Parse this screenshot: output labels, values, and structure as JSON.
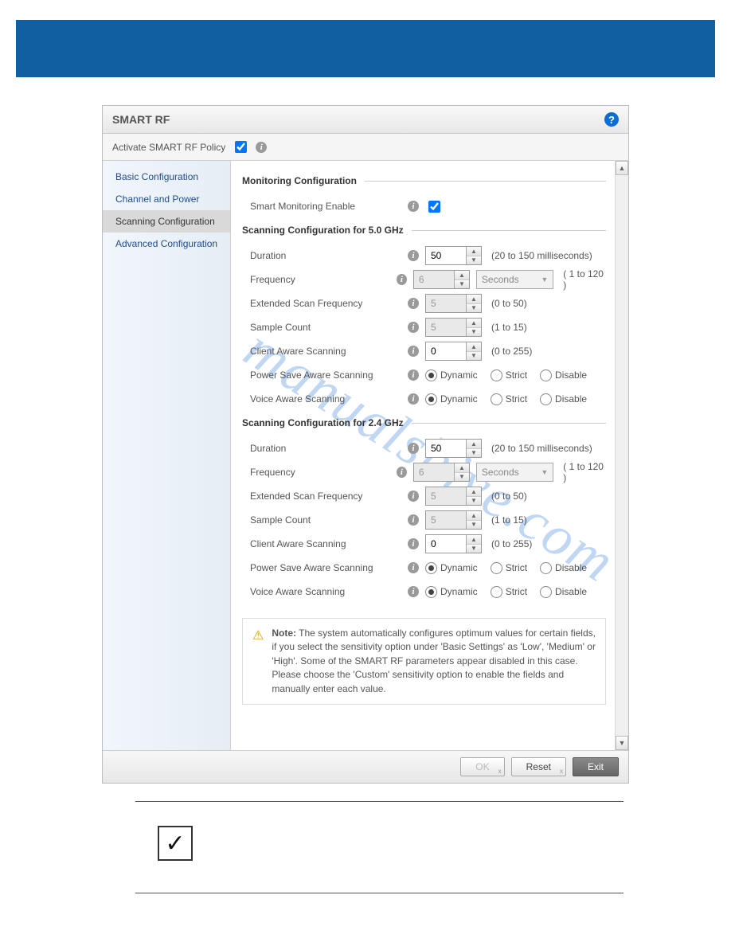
{
  "panel": {
    "title": "SMART RF",
    "activateLabel": "Activate SMART RF Policy",
    "activateChecked": true
  },
  "sidebar": {
    "items": [
      {
        "label": "Basic Configuration",
        "selected": false
      },
      {
        "label": "Channel and Power",
        "selected": false
      },
      {
        "label": "Scanning Configuration",
        "selected": true
      },
      {
        "label": "Advanced Configuration",
        "selected": false
      }
    ]
  },
  "sections": {
    "monitoring": {
      "title": "Monitoring Configuration",
      "smartMonitoring": {
        "label": "Smart Monitoring Enable",
        "checked": true
      }
    },
    "cfg5": {
      "title": "Scanning Configuration for 5.0 GHz",
      "duration": {
        "label": "Duration",
        "value": "50",
        "hint": "(20 to 150 milliseconds)"
      },
      "frequency": {
        "label": "Frequency",
        "value": "6",
        "unit": "Seconds",
        "hint": "( 1 to 120 )",
        "disabled": true
      },
      "extFreq": {
        "label": "Extended Scan Frequency",
        "value": "5",
        "hint": "(0 to 50)",
        "disabled": true
      },
      "sampleCount": {
        "label": "Sample Count",
        "value": "5",
        "hint": "(1 to 15)",
        "disabled": true
      },
      "clientAware": {
        "label": "Client Aware Scanning",
        "value": "0",
        "hint": "(0 to 255)"
      },
      "powerSave": {
        "label": "Power Save Aware Scanning",
        "options": [
          "Dynamic",
          "Strict",
          "Disable"
        ],
        "selected": "Dynamic"
      },
      "voiceAware": {
        "label": "Voice Aware Scanning",
        "options": [
          "Dynamic",
          "Strict",
          "Disable"
        ],
        "selected": "Dynamic"
      }
    },
    "cfg24": {
      "title": "Scanning Configuration for 2.4 GHz",
      "duration": {
        "label": "Duration",
        "value": "50",
        "hint": "(20 to 150 milliseconds)"
      },
      "frequency": {
        "label": "Frequency",
        "value": "6",
        "unit": "Seconds",
        "hint": "( 1 to 120 )",
        "disabled": true
      },
      "extFreq": {
        "label": "Extended Scan Frequency",
        "value": "5",
        "hint": "(0 to 50)",
        "disabled": true
      },
      "sampleCount": {
        "label": "Sample Count",
        "value": "5",
        "hint": "(1 to 15)",
        "disabled": true
      },
      "clientAware": {
        "label": "Client Aware Scanning",
        "value": "0",
        "hint": "(0 to 255)"
      },
      "powerSave": {
        "label": "Power Save Aware Scanning",
        "options": [
          "Dynamic",
          "Strict",
          "Disable"
        ],
        "selected": "Dynamic"
      },
      "voiceAware": {
        "label": "Voice Aware Scanning",
        "options": [
          "Dynamic",
          "Strict",
          "Disable"
        ],
        "selected": "Dynamic"
      }
    }
  },
  "note": {
    "prefix": "Note:",
    "text": " The system automatically configures optimum values for certain fields, if you select the sensitivity option under 'Basic Settings' as 'Low', 'Medium' or 'High'. Some of the SMART RF parameters appear disabled in this case. Please choose the 'Custom' sensitivity option to enable the fields and manually enter each value."
  },
  "buttons": {
    "ok": "OK",
    "reset": "Reset",
    "exit": "Exit"
  },
  "watermark": "manualshive.com"
}
